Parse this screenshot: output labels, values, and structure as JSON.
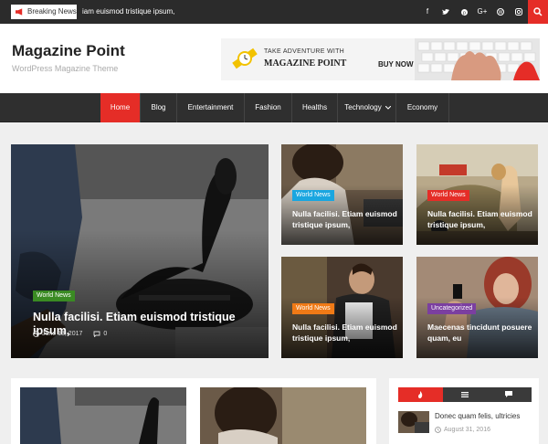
{
  "topbar": {
    "breaking_label": "Breaking News",
    "ticker": "iam euismod tristique ipsum,",
    "socials": [
      "f",
      "t",
      "p",
      "G+",
      "w",
      "ig"
    ]
  },
  "header": {
    "site_title": "Magazine Point",
    "tagline": "WordPress Magazine Theme",
    "ad": {
      "line1": "TAKE ADVENTURE WITH",
      "line2": "MAGAZINE POINT",
      "cta": "BUY NOW"
    }
  },
  "nav": {
    "items": [
      "Home",
      "Blog",
      "Entertainment",
      "Fashion",
      "Healths",
      "Technology",
      "Economy"
    ]
  },
  "featured": {
    "main": {
      "category": "World News",
      "title": "Nulla facilisi. Etiam euismod tristique ipsum,",
      "date": "June 13, 2017",
      "comments": "0"
    },
    "small": [
      {
        "category": "World News",
        "title": "Nulla facilisi. Etiam euismod tristique ipsum,"
      },
      {
        "category": "World News",
        "title": "Nulla facilisi. Etiam euismod tristique ipsum,"
      },
      {
        "category": "World News",
        "title": "Nulla facilisi. Etiam euismod tristique ipsum,"
      },
      {
        "category": "Uncategorized",
        "title": "Maecenas tincidunt posuere quam, eu"
      }
    ]
  },
  "sidebar": {
    "post_title": "Donec quam felis, ultricies",
    "post_date": "August 31, 2016"
  },
  "colors": {
    "accent": "#e52d27",
    "badge_green": "#3a8a23",
    "badge_blue": "#1aa6e0",
    "badge_orange": "#f07a16",
    "badge_purple": "#7b3fa0"
  }
}
